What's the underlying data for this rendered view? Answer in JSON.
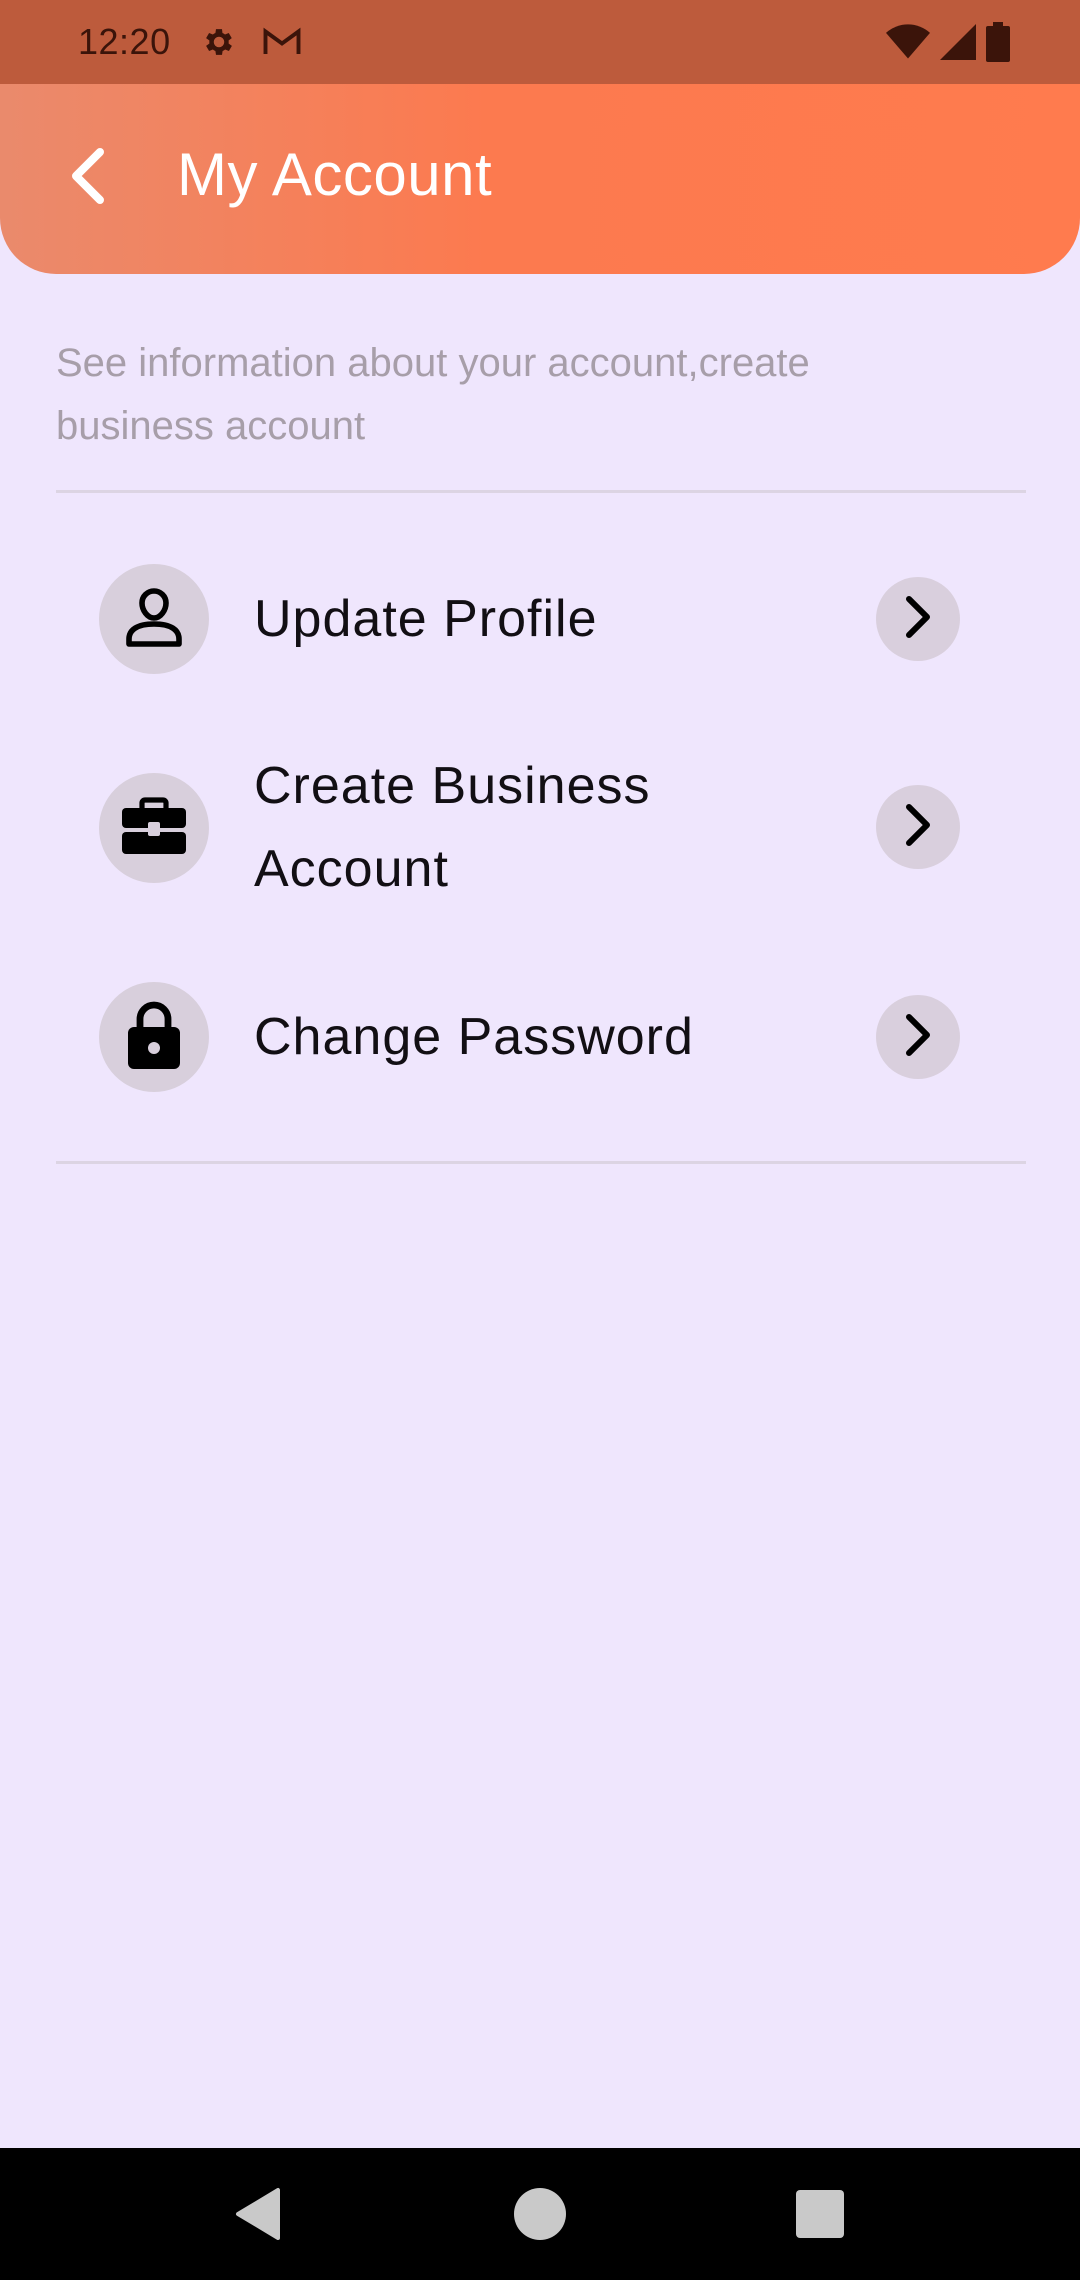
{
  "status_bar": {
    "time": "12:20",
    "icons": [
      "gear-icon",
      "gmail-icon",
      "wifi-icon",
      "cell-signal-icon",
      "battery-icon"
    ]
  },
  "header": {
    "title": "My Account",
    "back_icon": "chevron-left-icon",
    "gradient_colors": [
      "#ea8a6c",
      "#ff7b4e"
    ]
  },
  "description": "See information about your account,create business account",
  "menu": {
    "items": [
      {
        "label": "Update Profile",
        "icon": "user-icon"
      },
      {
        "label": "Create Business Account",
        "icon": "briefcase-icon"
      },
      {
        "label": "Change Password",
        "icon": "lock-icon"
      }
    ]
  },
  "nav": {
    "icons": [
      "back-triangle-icon",
      "home-circle-icon",
      "recents-square-icon"
    ]
  },
  "colors": {
    "background": "#efe6fd",
    "status_bar": "#bd5b3c",
    "accent": "#ff7b4e",
    "icon_circle": "#d8cfdc"
  }
}
